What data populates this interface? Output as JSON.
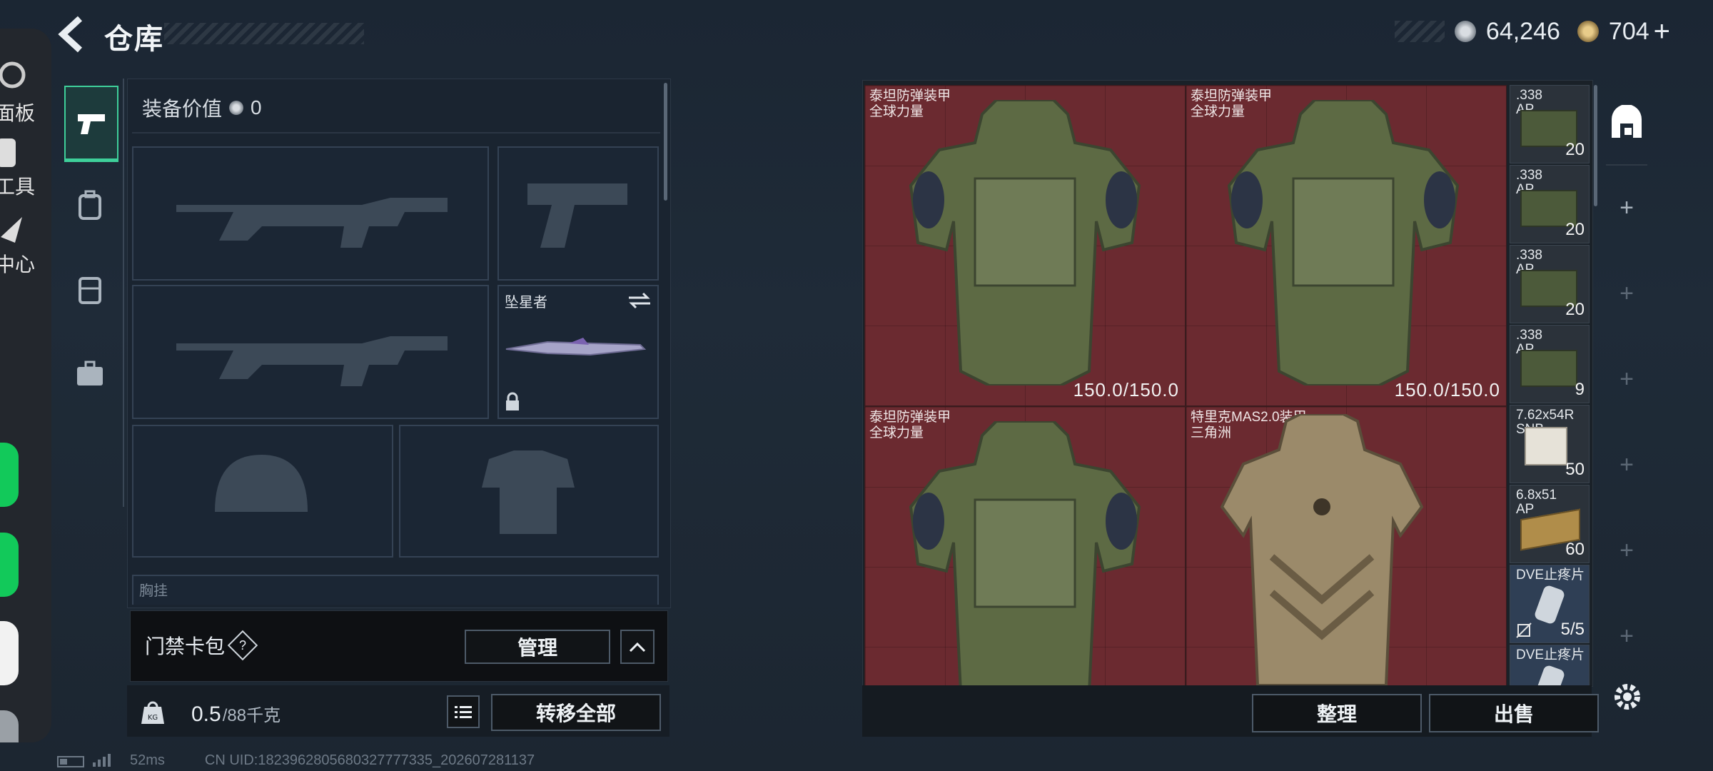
{
  "header": {
    "title": "仓库"
  },
  "currency": {
    "silver": "64,246",
    "gold": "704"
  },
  "dock": {
    "items": [
      "面板",
      "工具",
      "中心"
    ]
  },
  "loadout": {
    "equip_value_label": "装备价值",
    "equip_value": "0",
    "melee_name": "坠星者",
    "chest_rig_label": "胸挂",
    "keycard_label": "门禁卡包",
    "manage_label": "管理",
    "weight_value": "0.5",
    "weight_capacity": "/88千克",
    "transfer_all_label": "转移全部"
  },
  "stash": {
    "armors": [
      {
        "name1": "泰坦防弹装甲",
        "name2": "全球力量",
        "durability": "150.0/150.0"
      },
      {
        "name1": "泰坦防弹装甲",
        "name2": "全球力量",
        "durability": "150.0/150.0"
      },
      {
        "name1": "泰坦防弹装甲",
        "name2": "全球力量",
        "durability": ""
      },
      {
        "name1": "特里克MAS2.0装甲",
        "name2": "三角洲",
        "durability": ""
      }
    ],
    "ammo": [
      {
        "name1": ".338",
        "name2": "AP",
        "count": "20"
      },
      {
        "name1": ".338",
        "name2": "AP",
        "count": "20"
      },
      {
        "name1": ".338",
        "name2": "AP",
        "count": "20"
      },
      {
        "name1": ".338",
        "name2": "AP",
        "count": "9"
      },
      {
        "name1": "7.62x54R",
        "name2": "SNB",
        "count": "50"
      },
      {
        "name1": "6.8x51",
        "name2": "AP",
        "count": "60"
      },
      {
        "name1": "DVE止疼片",
        "name2": "",
        "count": "5/5"
      },
      {
        "name1": "DVE止疼片",
        "name2": "",
        "count": ""
      }
    ],
    "organize_label": "整理",
    "sell_label": "出售"
  },
  "status": {
    "ping": "52ms",
    "uid": "CN UID:1823962805680327777335_202607281137"
  },
  "colors": {
    "armor_bg": "#6b2a30",
    "accent_green": "#3ecf9a"
  }
}
